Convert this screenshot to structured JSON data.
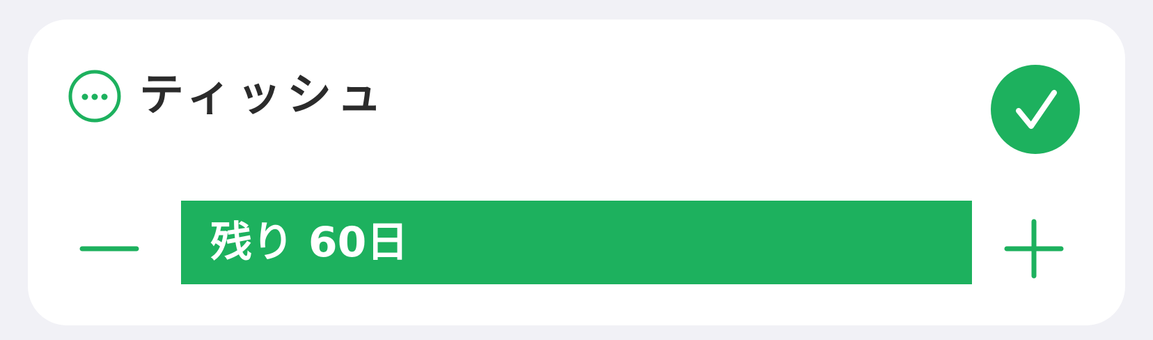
{
  "item": {
    "name": "ティッシュ",
    "remaining_label": "残り 60日",
    "remaining_fraction": 1.0
  },
  "icons": {
    "more": "more-horizontal-circle-icon",
    "check": "checkmark-icon",
    "minus": "minus-icon",
    "plus": "plus-icon"
  },
  "colors": {
    "accent": "#1db15e",
    "title_text": "#2b2b2b",
    "background": "#f1f1f6",
    "card": "#ffffff"
  }
}
